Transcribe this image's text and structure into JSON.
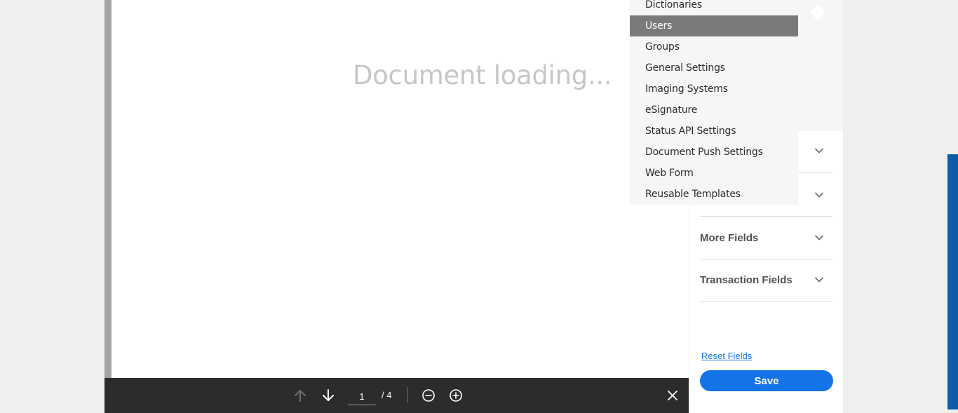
{
  "viewer": {
    "loading_text": "Document loading...",
    "toolbar": {
      "current_page": "1",
      "total_pages": "/ 4"
    }
  },
  "panel": {
    "sections": [
      {
        "label": ""
      },
      {
        "label": ""
      },
      {
        "label": "More Fields"
      },
      {
        "label": "Transaction Fields"
      }
    ],
    "reset_label": "Reset Fields",
    "save_label": "Save"
  },
  "menu": {
    "items": [
      {
        "label": "Dictionaries"
      },
      {
        "label": "Users"
      },
      {
        "label": "Groups"
      },
      {
        "label": "General Settings"
      },
      {
        "label": "Imaging Systems"
      },
      {
        "label": "eSignature"
      },
      {
        "label": "Status API Settings"
      },
      {
        "label": "Document Push Settings"
      },
      {
        "label": "Web Form"
      },
      {
        "label": "Reusable Templates"
      }
    ],
    "selected": "Users"
  },
  "colors": {
    "accent": "#1473e6",
    "toolbar_bg": "#2c2c2c",
    "menu_selected_bg": "#7a7a7a",
    "side_strip": "#0e5ca8"
  },
  "icons": [
    "arrow-up-icon",
    "arrow-down-icon",
    "zoom-out-icon",
    "zoom-in-icon",
    "close-icon",
    "chevron-down-icon"
  ]
}
